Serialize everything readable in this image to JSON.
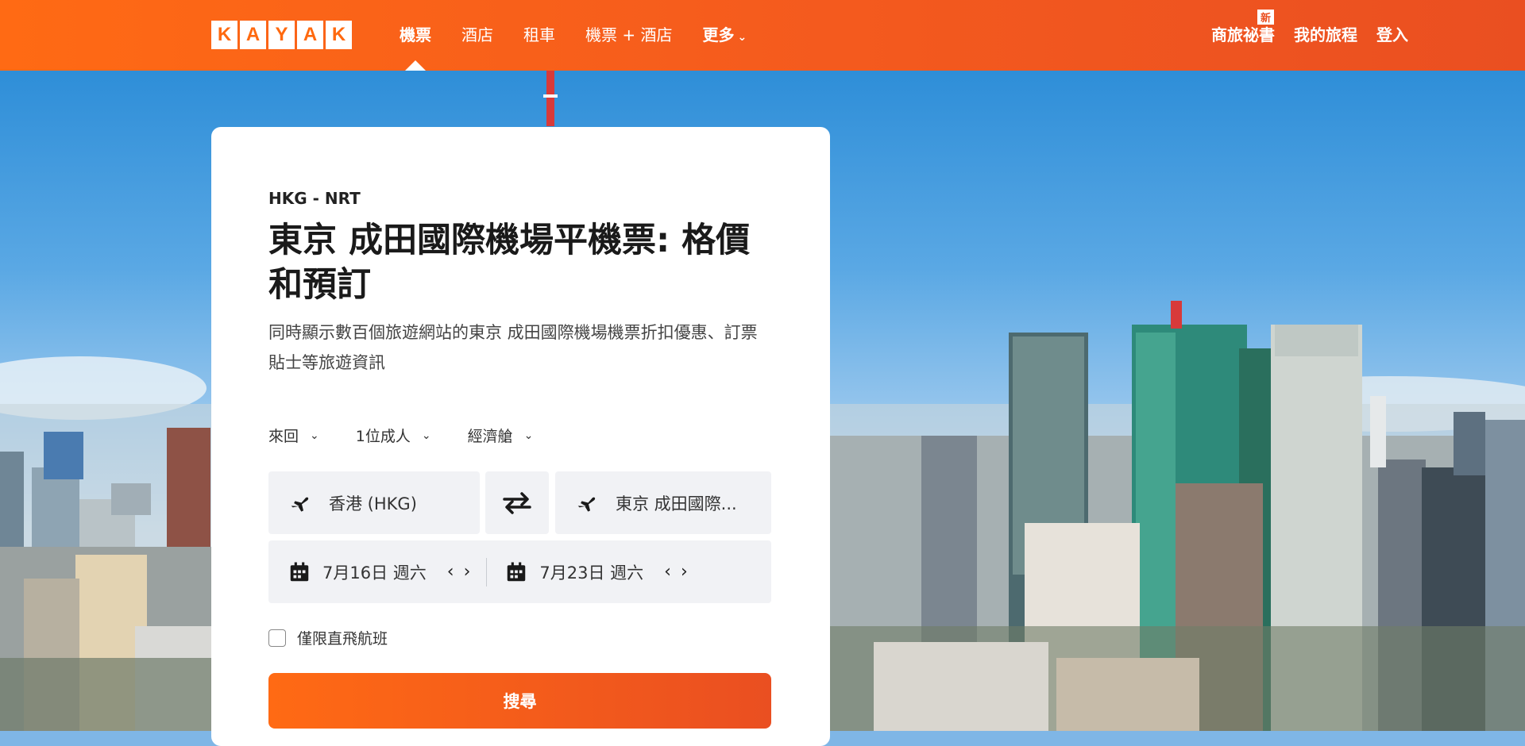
{
  "header": {
    "logo_letters": [
      "K",
      "A",
      "Y",
      "A",
      "K"
    ],
    "nav": [
      {
        "label": "機票"
      },
      {
        "label": "酒店"
      },
      {
        "label": "租車"
      },
      {
        "label": "機票 + 酒店"
      }
    ],
    "more_label": "更多",
    "right": {
      "business_label": "商旅祕書",
      "new_badge": "新",
      "trips_label": "我的旅程",
      "login_label": "登入"
    },
    "colors": {
      "brand": "#ff690f"
    }
  },
  "search_card": {
    "route": "HKG - NRT",
    "title": "東京 成田國際機場平機票: 格價和預訂",
    "subtitle": "同時顯示數百個旅遊網站的東京 成田國際機場機票折扣優惠、訂票貼士等旅遊資訊",
    "trip_type": "來回",
    "passengers": "1位成人",
    "cabin": "經濟艙",
    "from": "香港 (HKG)",
    "to": "東京 成田國際...",
    "depart_date": "7月16日 週六",
    "return_date": "7月23日 週六",
    "direct_label": "僅限直飛航班",
    "search_label": "搜尋",
    "icons": [
      "plane-icon",
      "swap-icon",
      "calendar-icon",
      "chevron-down-icon",
      "chevron-left-icon",
      "chevron-right-icon"
    ]
  }
}
